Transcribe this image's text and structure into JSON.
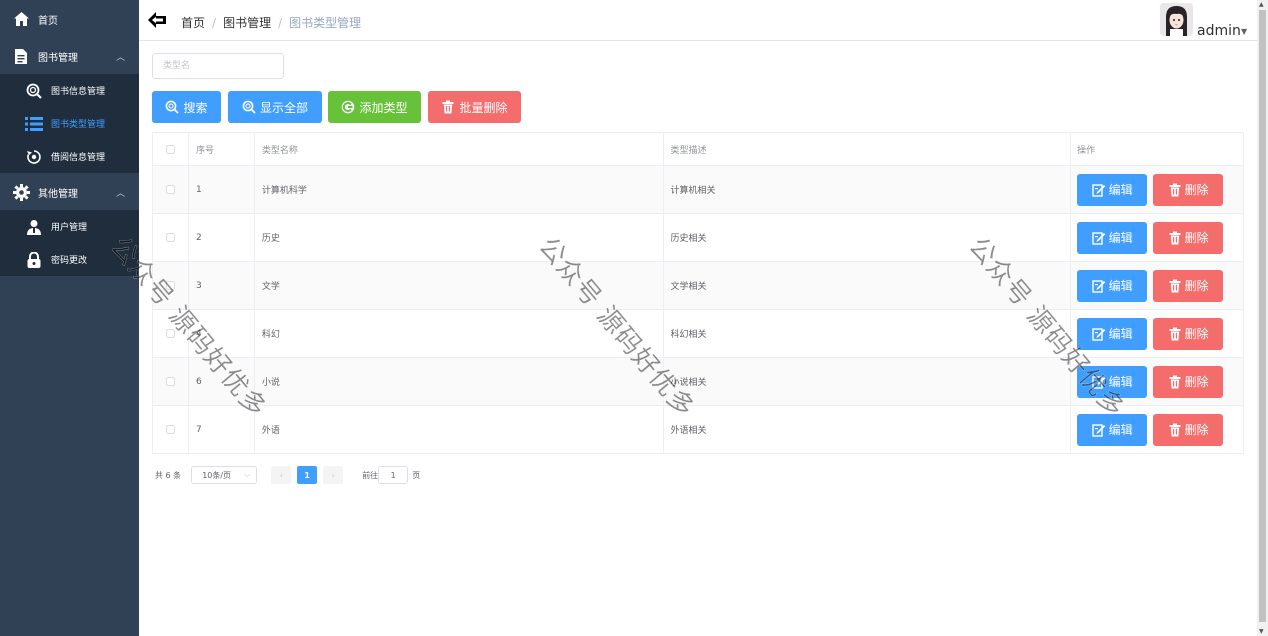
{
  "sidebar": {
    "home": {
      "label": "首页",
      "icon": "home-icon"
    },
    "book_mgmt": {
      "label": "图书管理",
      "icon": "document-icon",
      "items": [
        {
          "label": "图书信息管理",
          "icon": "search-icon"
        },
        {
          "label": "图书类型管理",
          "icon": "list-icon",
          "active": true
        },
        {
          "label": "借阅信息管理",
          "icon": "refresh-icon"
        }
      ]
    },
    "other_mgmt": {
      "label": "其他管理",
      "icon": "gear-icon",
      "items": [
        {
          "label": "用户管理",
          "icon": "user-icon"
        },
        {
          "label": "密码更改",
          "icon": "lock-icon"
        }
      ]
    }
  },
  "header": {
    "breadcrumb": [
      "首页",
      "图书管理",
      "图书类型管理"
    ],
    "separator": "/",
    "user": "admin"
  },
  "search": {
    "placeholder": "类型名",
    "value": ""
  },
  "toolbar": {
    "search_label": "搜索",
    "show_all_label": "显示全部",
    "add_label": "添加类型",
    "batch_delete_label": "批量删除"
  },
  "table": {
    "columns": [
      "序号",
      "类型名称",
      "类型描述",
      "操作"
    ],
    "edit_label": "编辑",
    "delete_label": "删除",
    "rows": [
      {
        "id": "1",
        "name": "计算机科学",
        "desc": "计算机相关"
      },
      {
        "id": "2",
        "name": "历史",
        "desc": "历史相关"
      },
      {
        "id": "3",
        "name": "文学",
        "desc": "文学相关"
      },
      {
        "id": "4",
        "name": "科幻",
        "desc": "科幻相关"
      },
      {
        "id": "6",
        "name": "小说",
        "desc": "小说相关"
      },
      {
        "id": "7",
        "name": "外语",
        "desc": "外语相关"
      }
    ]
  },
  "pagination": {
    "total": "共 6 条",
    "page_size": "10条/页",
    "current_page": "1",
    "goto_label": "前往",
    "goto_value": "1",
    "page_suffix": "页"
  },
  "watermark": "公众号 源码好优多",
  "colors": {
    "sidebar_bg": "#304156",
    "submenu_bg": "#1f2d3d",
    "primary": "#409eff",
    "success": "#67c23a",
    "danger": "#f56c6c"
  }
}
